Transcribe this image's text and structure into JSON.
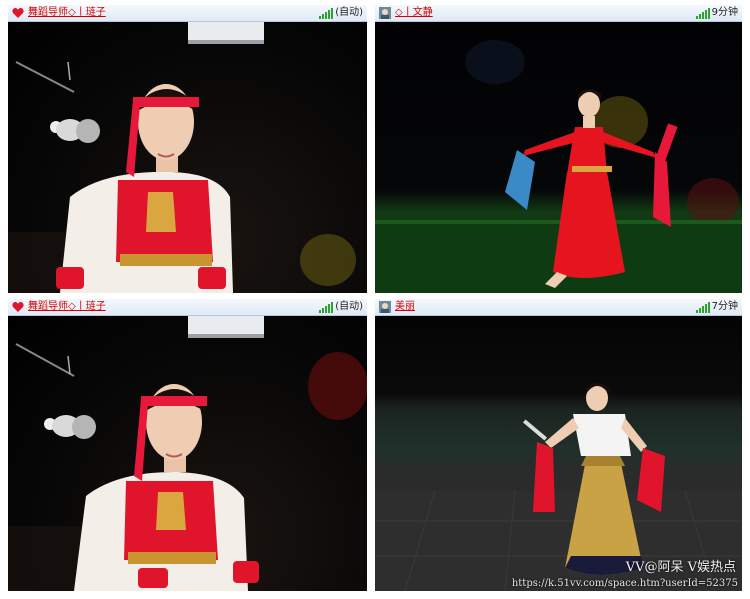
{
  "panels": [
    {
      "id": "top-left",
      "user": "舞蹈导师◇丨琏子",
      "icon": "heart-icon",
      "status": "(自动)",
      "signal": "full"
    },
    {
      "id": "top-right",
      "user": "◇丨文静",
      "icon": "user-avatar-icon",
      "status": "9分钟",
      "signal": "full"
    },
    {
      "id": "bottom-left",
      "user": "舞蹈导师◇丨琏子",
      "icon": "heart-icon",
      "status": "(自动)",
      "signal": "full"
    },
    {
      "id": "bottom-right",
      "user": "美丽",
      "icon": "user-avatar-icon",
      "status": "7分钟",
      "signal": "full"
    }
  ],
  "watermark": {
    "text": "VV@阿呆   V娱热点",
    "url": "https://k.51vv.com/space.htm?userId=52375"
  },
  "colors": {
    "username": "#d40000",
    "titlebar": "#dfe9f5",
    "signal": "#2ea42e",
    "costume_red": "#e0142a",
    "skirt_gold": "#c9a246"
  }
}
